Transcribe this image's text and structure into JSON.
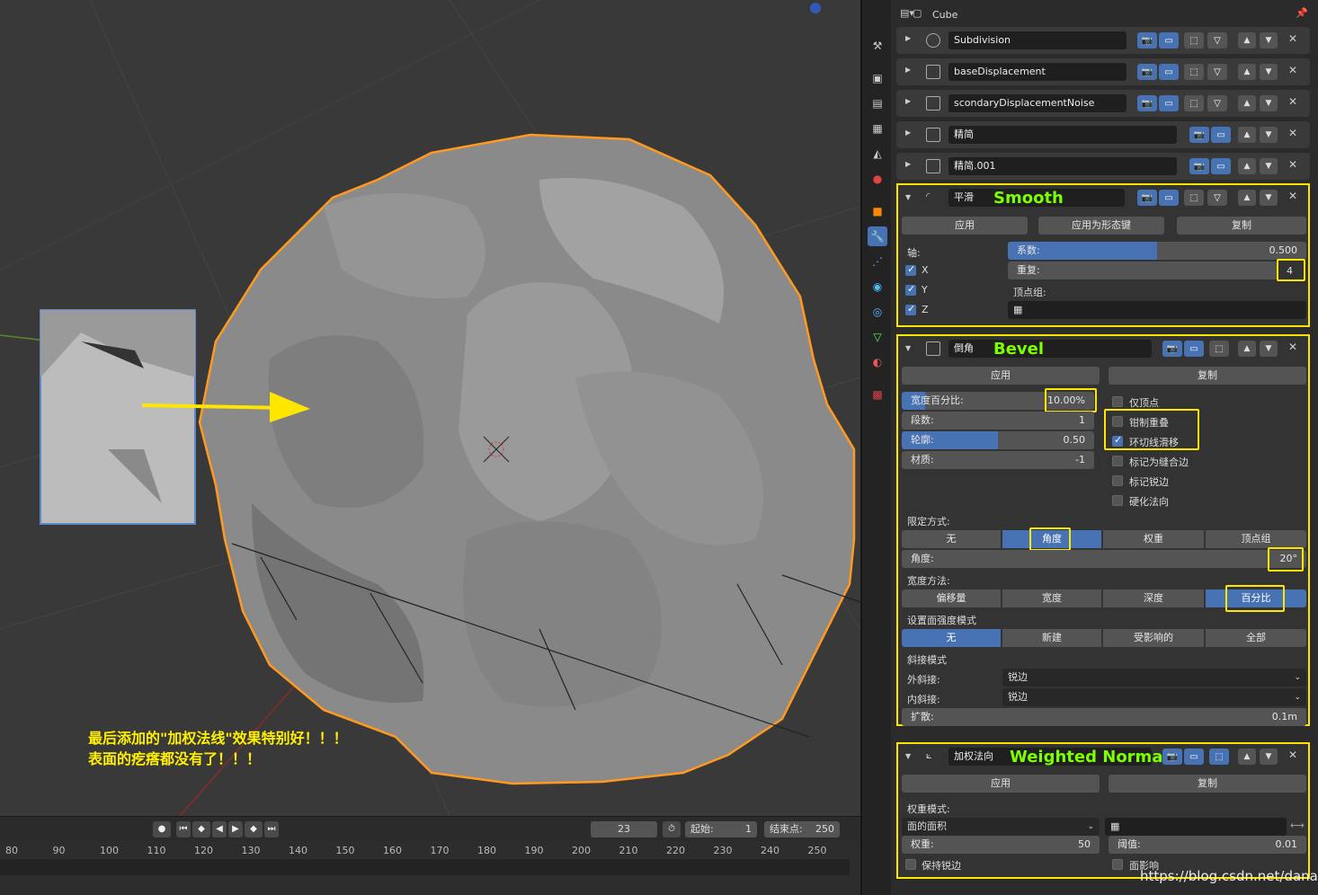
{
  "viewport": {
    "annotation_line1": "最后添加的\"加权法线\"效果特别好！！！",
    "annotation_line2": "表面的疙瘩都没有了！！！"
  },
  "timeline": {
    "current_frame": "23",
    "start_label": "起始:",
    "start_value": "1",
    "end_label": "结束点:",
    "end_value": "250",
    "ticks": [
      "80",
      "90",
      "100",
      "110",
      "120",
      "130",
      "140",
      "150",
      "160",
      "170",
      "180",
      "190",
      "200",
      "210",
      "220",
      "230",
      "240",
      "250"
    ]
  },
  "header": {
    "object_name": "Cube"
  },
  "modifiers": [
    {
      "name": "Subdivision"
    },
    {
      "name": "baseDisplacement"
    },
    {
      "name": "scondaryDisplacementNoise"
    },
    {
      "name": "精简"
    },
    {
      "name": "精简.001"
    }
  ],
  "smooth": {
    "name": "平滑",
    "big_label": "Smooth",
    "apply": "应用",
    "apply_shape": "应用为形态键",
    "copy": "复制",
    "axis_label": "轴:",
    "factor_label": "系数:",
    "factor_value": "0.500",
    "factor_fill": 0.5,
    "repeat_label": "重复:",
    "repeat_value": "4",
    "vgroup_label": "顶点组:",
    "x": "X",
    "y": "Y",
    "z": "Z"
  },
  "bevel": {
    "name": "倒角",
    "big_label": "Bevel",
    "apply": "应用",
    "copy": "复制",
    "width_label": "宽度百分比:",
    "width_value": "10.00%",
    "segments_label": "段数:",
    "segments_value": "1",
    "profile_label": "轮廓:",
    "profile_value": "0.50",
    "profile_fill": 0.5,
    "material_label": "材质:",
    "material_value": "-1",
    "only_vertices": "仅顶点",
    "clamp_overlap": "钳制重叠",
    "loop_slide": "环切线滑移",
    "mark_seam": "标记为缝合边",
    "mark_sharp": "标记锐边",
    "harden_normals": "硬化法向",
    "limit_label": "限定方式:",
    "limit_opts": [
      "无",
      "角度",
      "权重",
      "顶点组"
    ],
    "angle_label": "角度:",
    "angle_value": "20°",
    "width_method_label": "宽度方法:",
    "width_opts": [
      "偏移量",
      "宽度",
      "深度",
      "百分比"
    ],
    "face_strength_label": "设置面强度模式",
    "face_opts": [
      "无",
      "新建",
      "受影响的",
      "全部"
    ],
    "miter_label": "斜接模式",
    "outer_label": "外斜接:",
    "outer_value": "锐边",
    "inner_label": "内斜接:",
    "inner_value": "锐边",
    "spread_label": "扩散:",
    "spread_value": "0.1m"
  },
  "weighted": {
    "name": "加权法向",
    "big_label": "Weighted Normal",
    "apply": "应用",
    "copy": "复制",
    "mode_label": "权重模式:",
    "mode_value": "面的面积",
    "weight_label": "权重:",
    "weight_value": "50",
    "threshold_label": "阈值:",
    "threshold_value": "0.01",
    "keep_sharp": "保持锐边",
    "face_influence": "面影响"
  },
  "watermark": "https://blog.csdn.net/danad"
}
